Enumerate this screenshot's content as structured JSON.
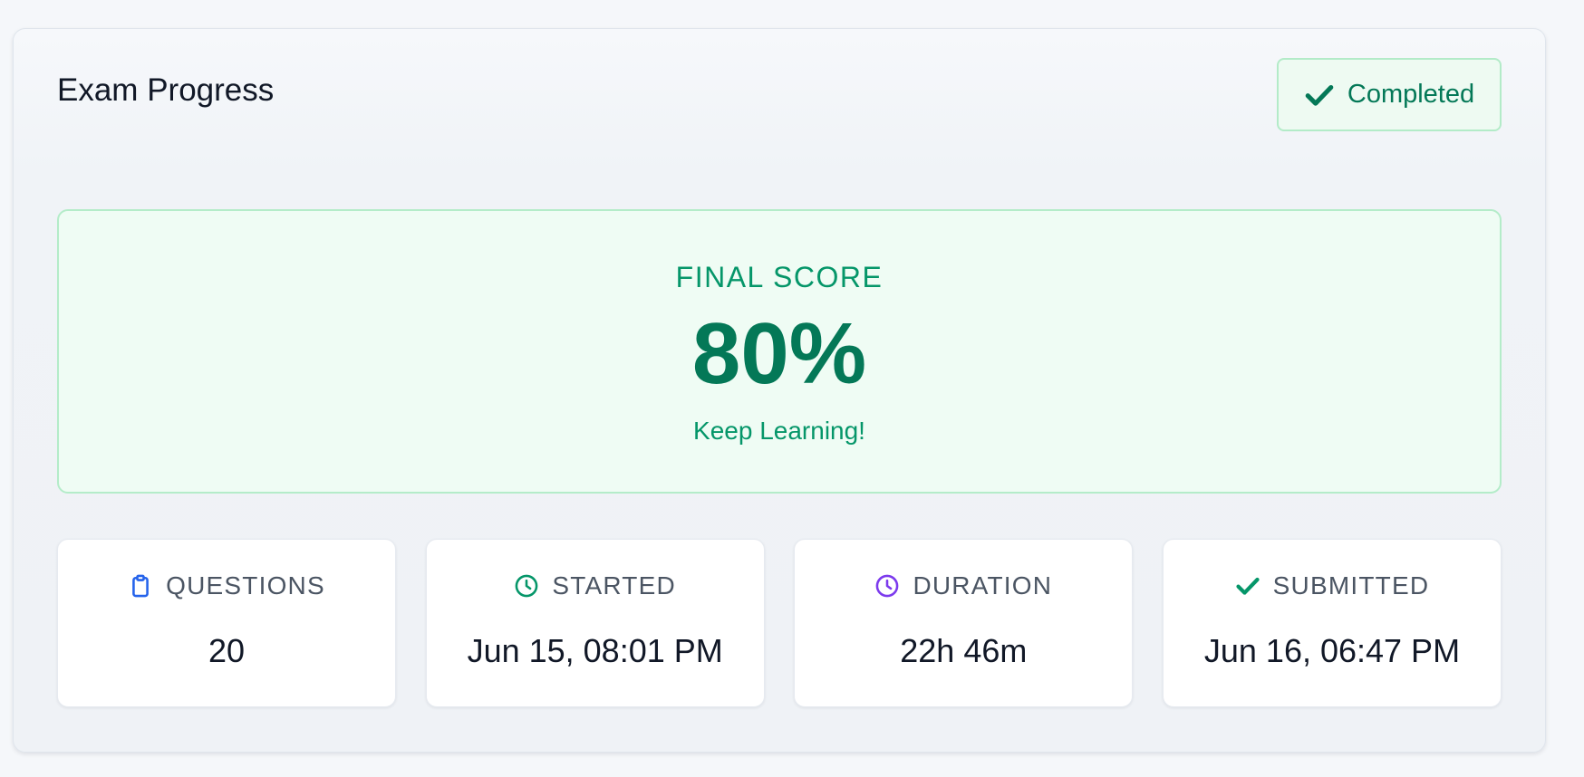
{
  "header": {
    "title": "Exam Progress",
    "status_label": "Completed"
  },
  "score": {
    "label": "FINAL SCORE",
    "value": "80%",
    "message": "Keep Learning!"
  },
  "stats": [
    {
      "label": "QUESTIONS",
      "value": "20",
      "icon": "clipboard-icon",
      "color": "#2563eb"
    },
    {
      "label": "STARTED",
      "value": "Jun 15, 08:01 PM",
      "icon": "clock-icon",
      "color": "#059669"
    },
    {
      "label": "DURATION",
      "value": "22h 46m",
      "icon": "clock-icon",
      "color": "#7c3aed"
    },
    {
      "label": "SUBMITTED",
      "value": "Jun 16, 06:47 PM",
      "icon": "check-icon",
      "color": "#059669"
    }
  ],
  "colors": {
    "accent_green": "#059669",
    "dark_green": "#047857",
    "panel_bg": "#effcf4"
  }
}
